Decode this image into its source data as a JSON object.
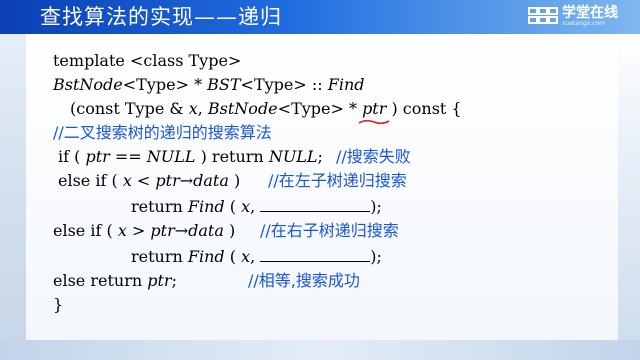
{
  "slide": {
    "title": "查找算法的实现——递归",
    "logo": {
      "name": "学堂在线",
      "subtitle": "xuetangx.com",
      "icon": "logo-grid-icon"
    },
    "accent_color": "#1a55d6",
    "header_color": "#1f6de0",
    "annotation_color": "#e02020"
  },
  "code": {
    "l1": "template <class Type>",
    "l2_a": "BstNode",
    "l2_b": "<Type> * ",
    "l2_c": "BST",
    "l2_d": "<Type> :: ",
    "l2_e": "Find",
    "l3_a": "(const Type & ",
    "l3_b": "x",
    "l3_c": ", ",
    "l3_d": "BstNode",
    "l3_e": "<Type> * ",
    "l3_f": "ptr",
    "l3_g": " ) const {",
    "l4_comment": "//二叉搜索树的递归的搜索算法",
    "l5_a": "if ( ",
    "l5_b": "ptr",
    "l5_c": " == ",
    "l5_d": "NULL",
    "l5_e": " ) return ",
    "l5_f": "NULL",
    "l5_g": ";",
    "l5_comment": "//搜索失败",
    "l6_a": "else if ( ",
    "l6_b": "x",
    "l6_c": " < ",
    "l6_d": "ptr→data",
    "l6_e": " )",
    "l6_comment": "//在左子树递归搜索",
    "l7_a": "return ",
    "l7_b": "Find",
    "l7_c": " ( ",
    "l7_d": "x",
    "l7_e": ", ",
    "l7_f": ");",
    "l8_a": "else if ( ",
    "l8_b": "x",
    "l8_c": " > ",
    "l8_d": "ptr→data",
    "l8_e": " )",
    "l8_comment": "//在右子树递归搜索",
    "l9_a": "return ",
    "l9_b": "Find",
    "l9_c": " ( ",
    "l9_d": "x",
    "l9_e": ", ",
    "l9_f": ");",
    "l10_a": "else return ",
    "l10_b": "ptr",
    "l10_c": ";",
    "l10_comment": "//相等,搜索成功",
    "l11": "}"
  }
}
